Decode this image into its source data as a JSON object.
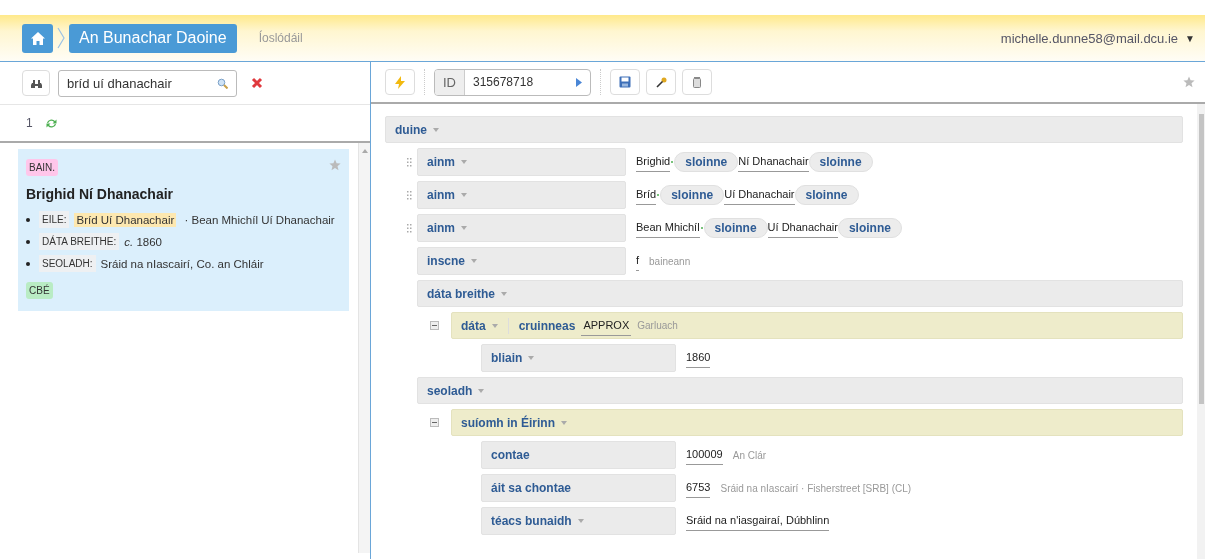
{
  "header": {
    "breadcrumb": "An Bunachar Daoine",
    "link": "Íoslódáil",
    "user": "michelle.dunne58@mail.dcu.ie",
    "user_caret": "▼"
  },
  "search": {
    "value": "bríd uí dhanachair"
  },
  "results": {
    "count": "1",
    "cards": [
      {
        "tag": "BAIN.",
        "name": "Brighid Ní Dhanachair",
        "starred": false,
        "facts": [
          {
            "label": "EILE:",
            "highlight": "Bríd Uí Dhanachair",
            "value": " · Bean Mhichíl Uí Dhanachair"
          },
          {
            "label": "DÁTA BREITHE:",
            "value": "*c.* 1860"
          },
          {
            "label": "SEOLADH:",
            "value": "Sráid na nIascairí, Co. an Chláir"
          }
        ],
        "source": "CBÉ"
      }
    ]
  },
  "editor": {
    "id_label": "ID",
    "id": "315678718",
    "starred": false,
    "tree": [
      {
        "kind": "group",
        "label": "duine",
        "caret": true,
        "children": [
          {
            "kind": "field",
            "label": "ainm",
            "caret": true,
            "handle": true,
            "parts": [
              {
                "kind": "text",
                "text": "Brighid"
              },
              {
                "kind": "dot"
              },
              {
                "kind": "chip",
                "text": "sloinne"
              },
              {
                "kind": "text",
                "text": "Ní Dhanachair"
              },
              {
                "kind": "chip",
                "text": "sloinne"
              }
            ]
          },
          {
            "kind": "field",
            "label": "ainm",
            "caret": true,
            "handle": true,
            "parts": [
              {
                "kind": "text",
                "text": "Bríd"
              },
              {
                "kind": "dot"
              },
              {
                "kind": "chip",
                "text": "sloinne"
              },
              {
                "kind": "text",
                "text": "Uí Dhanachair"
              },
              {
                "kind": "chip",
                "text": "sloinne"
              }
            ]
          },
          {
            "kind": "field",
            "label": "ainm",
            "caret": true,
            "handle": true,
            "parts": [
              {
                "kind": "text",
                "text": "Bean Mhichíl"
              },
              {
                "kind": "dot"
              },
              {
                "kind": "chip",
                "text": "sloinne"
              },
              {
                "kind": "text",
                "text": "Uí Dhanachair"
              },
              {
                "kind": "chip",
                "text": "sloinne"
              }
            ]
          },
          {
            "kind": "field",
            "label": "inscne",
            "caret": true,
            "handle": false,
            "parts": [
              {
                "kind": "text",
                "text": "f"
              },
              {
                "kind": "gloss",
                "text": "baineann"
              }
            ]
          },
          {
            "kind": "group",
            "label": "dáta breithe",
            "caret": true,
            "children": [
              {
                "kind": "subgroup",
                "label": "dáta",
                "caret": true,
                "expanded": true,
                "attr": {
                  "label": "cruinneas",
                  "value": "APPROX",
                  "gloss": "Garluach"
                },
                "children": [
                  {
                    "kind": "field",
                    "label": "bliain",
                    "caret": true,
                    "handle": false,
                    "parts": [
                      {
                        "kind": "text",
                        "text": "1860"
                      }
                    ]
                  }
                ]
              }
            ]
          },
          {
            "kind": "group",
            "label": "seoladh",
            "caret": true,
            "children": [
              {
                "kind": "subgroup",
                "label": "suíomh in Éirinn",
                "caret": true,
                "expanded": true,
                "children": [
                  {
                    "kind": "field",
                    "label": "contae",
                    "caret": false,
                    "handle": false,
                    "parts": [
                      {
                        "kind": "text",
                        "text": "100009"
                      },
                      {
                        "kind": "gloss",
                        "text": "An Clár"
                      }
                    ]
                  },
                  {
                    "kind": "field",
                    "label": "áit sa chontae",
                    "caret": false,
                    "handle": false,
                    "parts": [
                      {
                        "kind": "text",
                        "text": "6753"
                      },
                      {
                        "kind": "gloss",
                        "text": "Sráid na nIascairí · Fisherstreet [SRB] (CL)"
                      }
                    ]
                  },
                  {
                    "kind": "field",
                    "label": "téacs bunaidh",
                    "caret": true,
                    "handle": false,
                    "parts": [
                      {
                        "kind": "text",
                        "text": "Sráid na n'iasgairaí, Dúbhlinn"
                      }
                    ]
                  }
                ]
              }
            ]
          }
        ]
      }
    ]
  }
}
